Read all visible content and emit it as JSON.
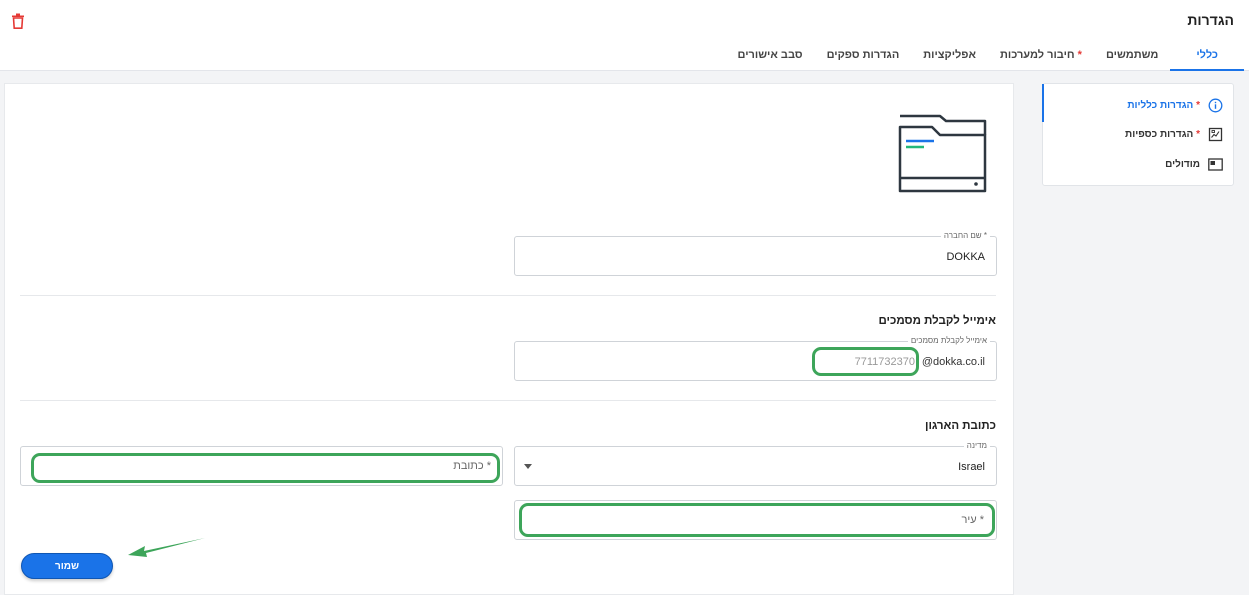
{
  "header": {
    "title": "הגדרות",
    "trash_icon": "trash-icon",
    "tabs": [
      {
        "label": "כללי",
        "active": true
      },
      {
        "label": "משתמשים",
        "active": false
      },
      {
        "label": "חיבור למערכות",
        "required": true,
        "active": false
      },
      {
        "label": "אפליקציות",
        "active": false
      },
      {
        "label": "הגדרות ספקים",
        "active": false
      },
      {
        "label": "סבב אישורים",
        "active": false
      }
    ]
  },
  "sidebar": {
    "items": [
      {
        "label": "הגדרות כלליות",
        "required": true,
        "icon": "info-icon",
        "active": true
      },
      {
        "label": "הגדרות כספיות",
        "required": true,
        "icon": "finance-icon",
        "active": false
      },
      {
        "label": "מודולים",
        "required": false,
        "icon": "modules-icon",
        "active": false
      }
    ]
  },
  "form": {
    "company_name": {
      "label": "שם החברה",
      "required_mark": "*",
      "value": "DOKKA"
    },
    "email_section": {
      "title": "אימייל לקבלת מסמכים",
      "label": "אימייל לקבלת מסמכים",
      "value": "7711732370",
      "suffix": "@dokka.co.il"
    },
    "address_section": {
      "title": "כתובת הארגון",
      "country": {
        "label": "מדינה",
        "value": "Israel"
      },
      "address": {
        "placeholder": "כתובת *"
      },
      "city": {
        "placeholder": "עיר *"
      }
    },
    "save_label": "שמור"
  },
  "colors": {
    "accent": "#1a73e8",
    "highlight": "#3da55a",
    "required": "#e53935"
  }
}
